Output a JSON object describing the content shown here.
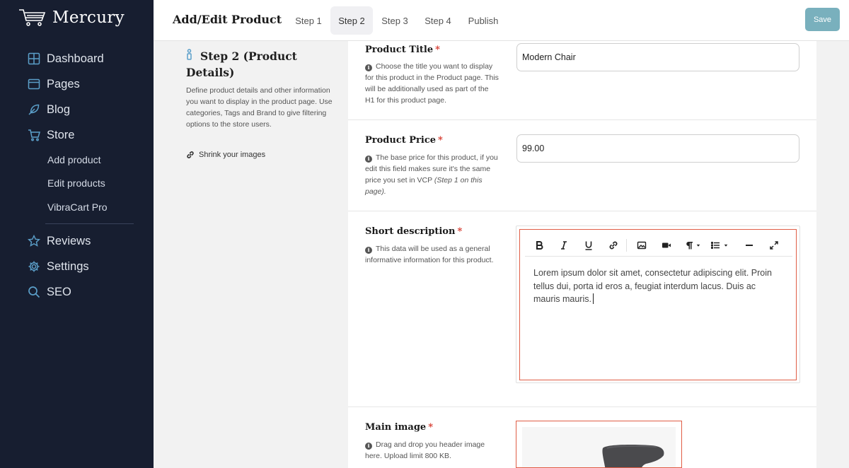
{
  "sidebar": {
    "brand": "Mercury",
    "items": [
      {
        "label": "Dashboard",
        "icon": "dashboard-icon"
      },
      {
        "label": "Pages",
        "icon": "pages-icon"
      },
      {
        "label": "Blog",
        "icon": "feather-icon"
      },
      {
        "label": "Store",
        "icon": "cart-icon"
      },
      {
        "label": "Reviews",
        "icon": "star-icon"
      },
      {
        "label": "Settings",
        "icon": "gear-icon"
      },
      {
        "label": "SEO",
        "icon": "search-icon"
      }
    ],
    "store_sub_items": [
      "Add product",
      "Edit products",
      "VibraCart Pro"
    ]
  },
  "header": {
    "title": "Add/Edit Product",
    "steps": [
      "Step 1",
      "Step 2",
      "Step 3",
      "Step 4",
      "Publish"
    ],
    "active_step": "Step 2",
    "save_label": "Save"
  },
  "step_info": {
    "heading": "Step 2 (Product Details)",
    "description": "Define product details and other information you want to display in the product page. Use categories, Tags and Brand to give filtering options to the store users.",
    "link_label": "Shrink your images"
  },
  "fields": {
    "title": {
      "label": "Product Title",
      "required_mark": "*",
      "help": "Choose the title you want to display for this product in the Product page. This will be additionally used as part of the H1 for this product page.",
      "value": "Modern Chair"
    },
    "price": {
      "label": "Product Price",
      "required_mark": "*",
      "help_main": "The base price for this product, if you edit this field makes sure it's the same price you set in VCP ",
      "help_emphasis": "(Step 1 on this page).",
      "value": "99.00"
    },
    "short_description": {
      "label": "Short description",
      "required_mark": "*",
      "help": "This data will be used as a general informative information for this product.",
      "content": "Lorem ipsum dolor sit amet, consectetur adipiscing elit. Proin tellus dui, porta id eros a, feugiat interdum lacus. Duis ac mauris mauris."
    },
    "main_image": {
      "label": "Main image",
      "required_mark": "*",
      "help": "Drag and drop you header image here. Upload limit 800 KB."
    }
  },
  "editor_toolbar": [
    "bold-icon",
    "italic-icon",
    "underline-icon",
    "link-icon",
    "image-icon",
    "video-icon",
    "paragraph-icon",
    "list-icon",
    "horizontal-rule-icon",
    "fullscreen-icon"
  ],
  "colors": {
    "sidebar_bg": "#171e30",
    "save_button": "#79b0bd",
    "required": "#d63a2f",
    "focus_border": "#e05d45"
  }
}
